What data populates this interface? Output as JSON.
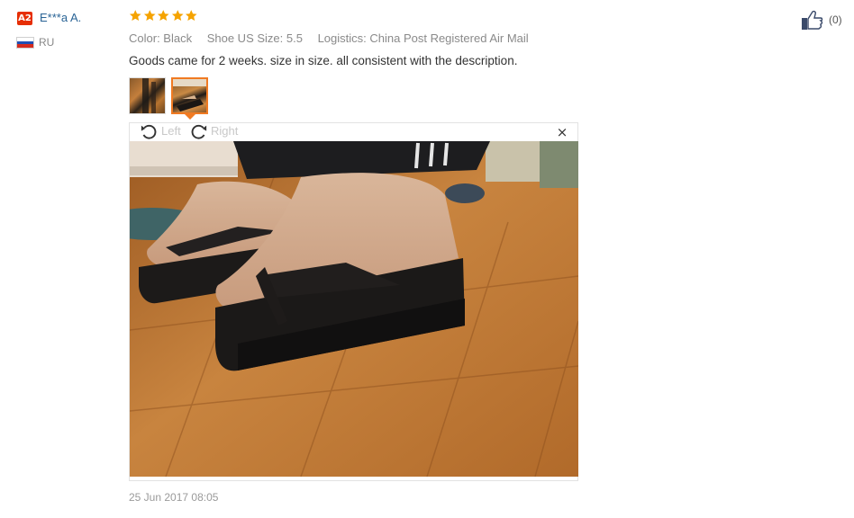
{
  "review": {
    "user": {
      "level_badge": "A2",
      "name": "E***a A.",
      "country": "RU",
      "flag_colors": [
        "#ffffff",
        "#1f4fb4",
        "#d52b1e"
      ]
    },
    "rating": {
      "stars": 5,
      "max": 5,
      "star_color": "#f5a300"
    },
    "attributes": [
      "Color: Black",
      "Shoe US Size: 5.5",
      "Logistics: China Post Registered Air Mail"
    ],
    "text": "Goods came for 2 weeks. size in size. all consistent with the description.",
    "thumbnails": [
      {
        "icon": "photo-thumbnail",
        "selected": false
      },
      {
        "icon": "photo-thumbnail",
        "selected": true
      }
    ],
    "viewer": {
      "rotate_left_label": "Left",
      "rotate_right_label": "Right",
      "close_glyph": "×"
    },
    "date": "25 Jun 2017 08:05",
    "helpful": {
      "count": "(0)",
      "icon": "thumbs-up-icon"
    }
  },
  "colors": {
    "accent_orange": "#f07a22",
    "badge_red": "#e62e04",
    "link_blue": "#2a6496"
  }
}
